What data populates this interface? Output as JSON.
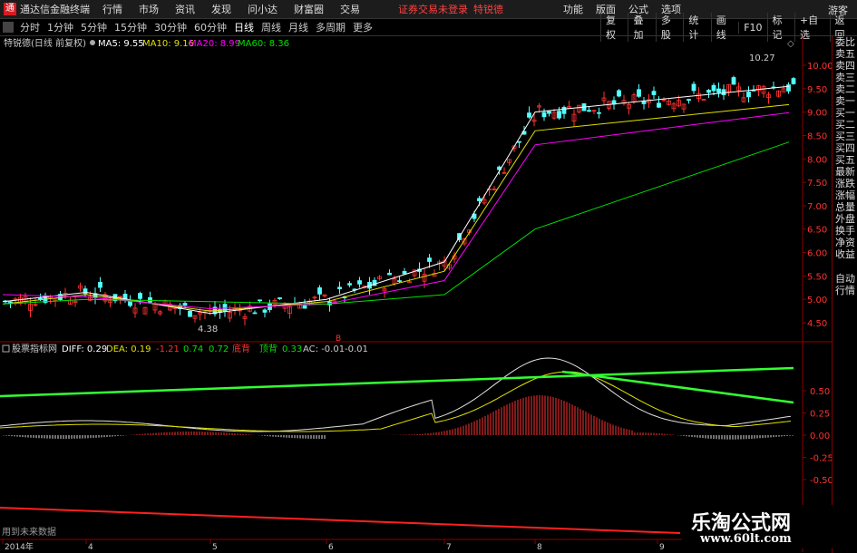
{
  "app": {
    "title": "通达信金融终端",
    "logo": "logo-icon"
  },
  "menu": [
    "行情",
    "市场",
    "资讯",
    "发现",
    "问小达",
    "财富圈",
    "交易"
  ],
  "notice": {
    "text": "证券交易未登录",
    "stock": "特锐德"
  },
  "right_menu": [
    "功能",
    "版面",
    "公式",
    "选项"
  ],
  "guest": "游客",
  "periods": [
    "分时",
    "1分钟",
    "5分钟",
    "15分钟",
    "30分钟",
    "60分钟",
    "日线",
    "周线",
    "月线",
    "多周期",
    "更多"
  ],
  "active_period": "日线",
  "right_toolbar": [
    "复权",
    "叠加",
    "多股",
    "统计",
    "画线",
    "F10",
    "标记",
    "+自选",
    "返回"
  ],
  "main_legend": {
    "stock": "特锐德(日线 前复权)",
    "ma5": "MA5: 9.55",
    "ma10": "MA10: 9.16",
    "ma20": "MA20: 8.99",
    "ma60": "MA60: 8.36"
  },
  "indicator_legend": {
    "name": "股票指标网",
    "diff": "DIFF: 0.29",
    "dea": "DEA: 0.19",
    "v1": "-1.21",
    "v2": "0.74",
    "v3": "0.72",
    "l1": "底背",
    "l2": "顶背",
    "v4": "0.33",
    "ac": "AC: -0.01",
    "v5": "-0.01"
  },
  "price_axis": [
    "10.00",
    "9.50",
    "9.00",
    "8.50",
    "8.00",
    "7.50",
    "7.00",
    "6.50",
    "6.00",
    "5.50",
    "5.00",
    "4.50"
  ],
  "indicator_axis": [
    "0.50",
    "0.25",
    "0.00",
    "-0.25",
    "-0.50"
  ],
  "annotations": {
    "high": "10.27",
    "low": "4.38",
    "marker": "B"
  },
  "footer_note": "用到未来数据",
  "dates": [
    "2014年",
    "4",
    "5",
    "6",
    "7",
    "8",
    "9"
  ],
  "side_panel": [
    "委比",
    "卖五",
    "卖四",
    "卖三",
    "卖二",
    "卖一",
    "买一",
    "买二",
    "买三",
    "买四",
    "买五",
    "最新",
    "涨跌",
    "涨幅",
    "总量",
    "外盘",
    "换手",
    "净资",
    "收益",
    "自动",
    "行情"
  ],
  "watermark": {
    "title": "乐淘公式网",
    "url": "www.60lt.com"
  },
  "colors": {
    "up": "#ff3232",
    "down": "#54ffff",
    "ma5": "#ffffff",
    "ma10": "#e0e000",
    "ma20": "#ff00ff",
    "ma60": "#00e000",
    "axis": "#8b0000"
  },
  "chart_data": {
    "type": "line",
    "x": [
      "2014-03",
      "2014-04",
      "2014-05",
      "2014-06",
      "2014-07",
      "2014-08",
      "2014-09"
    ],
    "series": [
      {
        "name": "MA5",
        "values": [
          4.95,
          5.15,
          4.7,
          5.0,
          5.8,
          9.0,
          9.55
        ]
      },
      {
        "name": "MA10",
        "values": [
          4.9,
          5.1,
          4.75,
          4.95,
          5.6,
          8.6,
          9.16
        ]
      },
      {
        "name": "MA20",
        "values": [
          5.1,
          5.05,
          4.8,
          4.9,
          5.4,
          8.3,
          8.99
        ]
      },
      {
        "name": "MA60",
        "values": [
          4.9,
          5.0,
          4.95,
          4.9,
          5.1,
          6.5,
          8.36
        ]
      }
    ],
    "ylim": [
      4.3,
      10.4
    ]
  }
}
